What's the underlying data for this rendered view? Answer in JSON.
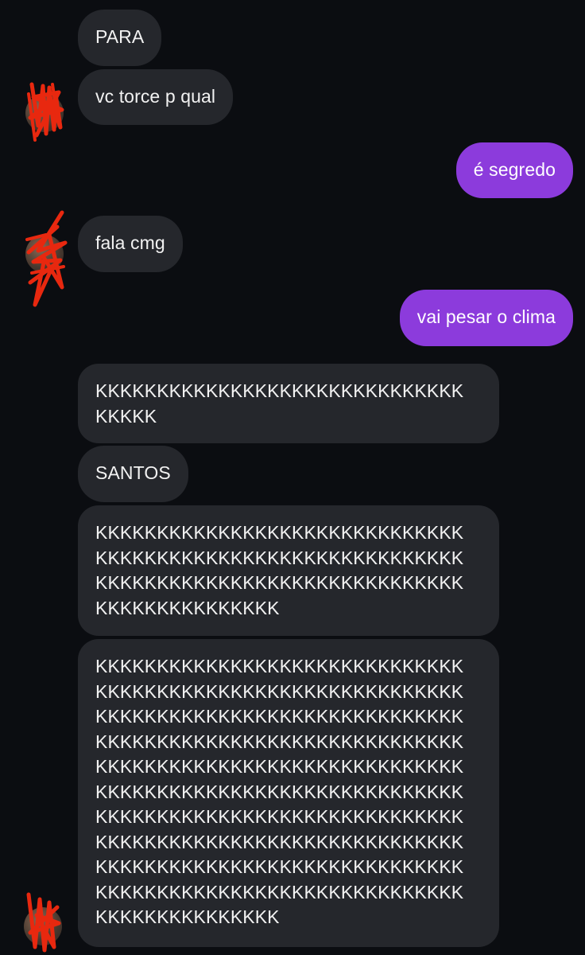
{
  "messages": [
    {
      "side": "in",
      "lines": [
        "PARA"
      ]
    },
    {
      "side": "in",
      "lines": [
        "vc torce p qual"
      ]
    },
    {
      "side": "out",
      "lines": [
        "é segredo"
      ]
    },
    {
      "side": "in",
      "lines": [
        "fala cmg"
      ]
    },
    {
      "side": "out",
      "lines": [
        "vai pesar o clima"
      ]
    },
    {
      "side": "in",
      "lines": [
        "KKKKKKKKKKKKKKKKKKKKKKKKKKKKKK",
        "KKKKK"
      ]
    },
    {
      "side": "in",
      "lines": [
        "SANTOS"
      ]
    },
    {
      "side": "in",
      "lines": [
        "KKKKKKKKKKKKKKKKKKKKKKKKKKKKKK",
        "KKKKKKKKKKKKKKKKKKKKKKKKKKKKKK",
        "KKKKKKKKKKKKKKKKKKKKKKKKKKKKKK",
        "KKKKKKKKKKKKKKK"
      ]
    },
    {
      "side": "in",
      "lines": [
        "KKKKKKKKKKKKKKKKKKKKKKKKKKKKKK",
        "KKKKKKKKKKKKKKKKKKKKKKKKKKKKKK",
        "KKKKKKKKKKKKKKKKKKKKKKKKKKKKKK",
        "KKKKKKKKKKKKKKKKKKKKKKKKKKKKKK",
        "KKKKKKKKKKKKKKKKKKKKKKKKKKKKKK",
        "KKKKKKKKKKKKKKKKKKKKKKKKKKKKKK",
        "KKKKKKKKKKKKKKKKKKKKKKKKKKKKKK",
        "KKKKKKKKKKKKKKKKKKKKKKKKKKKKKK",
        "KKKKKKKKKKKKKKKKKKKKKKKKKKKKKK",
        "KKKKKKKKKKKKKKKKKKKKKKKKKKKKKK",
        "KKKKKKKKKKKKKKK"
      ]
    }
  ],
  "colors": {
    "background": "#0b0d11",
    "incoming_bubble": "#25272c",
    "outgoing_bubble": "#8c3bdc",
    "text": "#f2f2f2",
    "redaction_scribble": "#e8280f"
  },
  "avatars": [
    {
      "icon": "contact-avatar-icon",
      "redacted": true
    },
    {
      "icon": "contact-avatar-icon",
      "redacted": true
    },
    {
      "icon": "contact-avatar-icon",
      "redacted": true
    }
  ]
}
